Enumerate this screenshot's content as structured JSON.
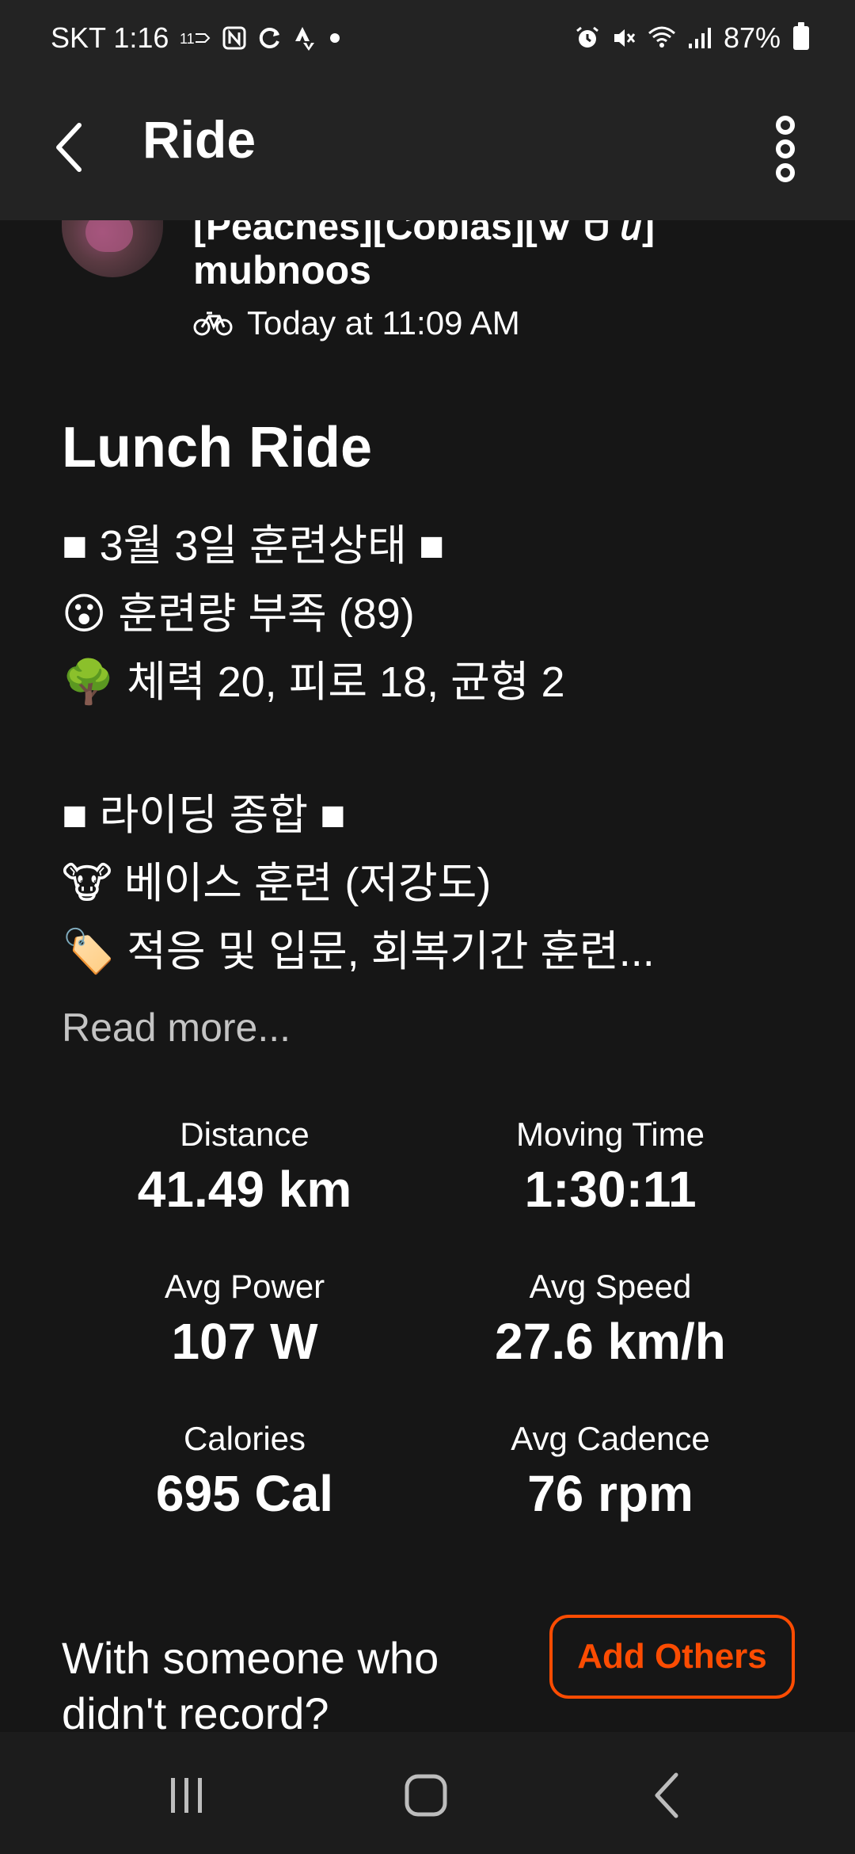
{
  "status_bar": {
    "carrier_time": "SKT 1:16",
    "left_icons": [
      "lte-plus-icon",
      "nfc-icon",
      "sync-icon",
      "strava-icon",
      "dot-icon"
    ],
    "right_icons": [
      "alarm-icon",
      "mute-icon",
      "wifi-icon",
      "signal-icon"
    ],
    "battery_text": "87%"
  },
  "app_bar": {
    "title": "Ride",
    "back_icon": "chevron-left-icon",
    "more_icon": "more-vertical-icon"
  },
  "athlete": {
    "club_text": "[Peaches][Cobias][Ꮤ Ꮜ ꞿ]",
    "name": "mubnoos",
    "activity_icon": "bicycle-icon",
    "timestamp": "Today at 11:09 AM"
  },
  "activity": {
    "title": "Lunch Ride",
    "description_lines": [
      "■ 3월 3일 훈련상태 ■",
      "😮 훈련량 부족 (89)",
      "🌳 체력 20, 피로 18, 균형 2",
      "",
      "■ 라이딩 종합 ■",
      "🐮 베이스 훈련 (저강도)",
      "🏷️ 적응 및 입문, 회복기간 훈련..."
    ],
    "read_more": "Read more..."
  },
  "stats": [
    {
      "label": "Distance",
      "value": "41.49 km"
    },
    {
      "label": "Moving Time",
      "value": "1:30:11"
    },
    {
      "label": "Avg Power",
      "value": "107 W"
    },
    {
      "label": "Avg Speed",
      "value": "27.6 km/h"
    },
    {
      "label": "Calories",
      "value": "695 Cal"
    },
    {
      "label": "Avg Cadence",
      "value": "76 rpm"
    }
  ],
  "with_others": {
    "prompt_line1": "With someone who",
    "prompt_line2": "didn't record?",
    "button_label": "Add Others"
  },
  "nav_bar": {
    "icons": [
      "recent-apps-icon",
      "home-icon",
      "back-icon"
    ]
  },
  "colors": {
    "background": "#161616",
    "bar_background": "#232323",
    "accent": "#fc4c02",
    "muted_text": "#c4c4c4"
  }
}
